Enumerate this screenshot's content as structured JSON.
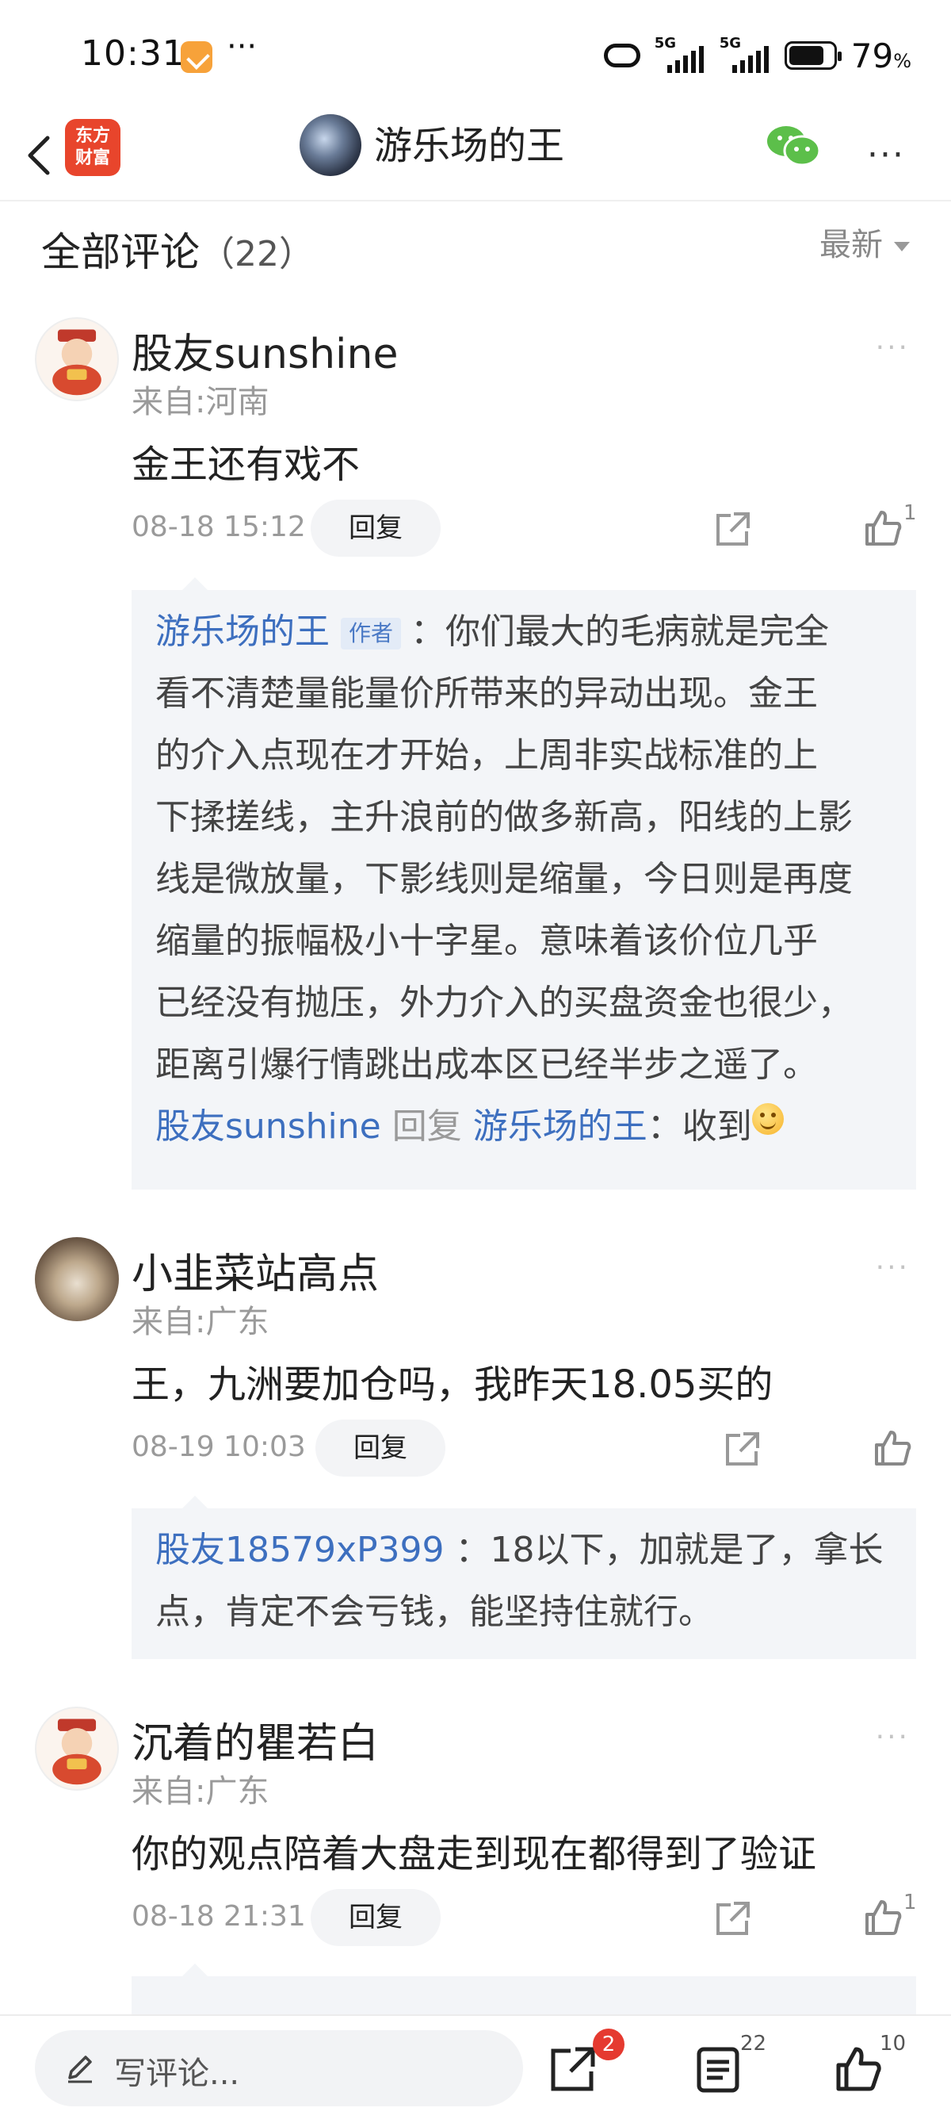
{
  "status": {
    "time": "10:31",
    "dots": "···",
    "net1": "5G",
    "net2": "5G",
    "battery": "79",
    "battery_unit": "%"
  },
  "header": {
    "logo_line1": "东方",
    "logo_line2": "财富",
    "title": "游乐场的王"
  },
  "section": {
    "title": "全部评论",
    "count": "（22）",
    "sort": "最新"
  },
  "comments": [
    {
      "user": "股友sunshine",
      "location": "来自:河南",
      "text": "金王还有戏不",
      "time": "08-18 15:12",
      "reply_label": "回复",
      "likes": "1",
      "replies": [
        {
          "author": "游乐场的王",
          "tag": "作者",
          "lines": [
            "：你们最大的毛病就是完全",
            "看不清楚量能量价所带来的异动出现。金王",
            "的介入点现在才开始，上周非实战标准的上",
            "下揉搓线，主升浪前的做多新高，阳线的上影",
            "线是微放量，下影线则是缩量，今日则是再度",
            "缩量的振幅极小十字星。意味着该价位几乎",
            "已经没有抛压，外力介入的买盘资金也很少，",
            "距离引爆行情跳出成本区已经半步之遥了。"
          ]
        },
        {
          "author": "股友sunshine",
          "verb": "回复",
          "target": "游乐场的王",
          "text": "：收到"
        }
      ]
    },
    {
      "user": "小韭菜站高点",
      "location": "来自:广东",
      "text": "王，九洲要加仓吗，我昨天18.05买的",
      "time": "08-19 10:03",
      "reply_label": "回复",
      "likes": "",
      "replies": [
        {
          "author": "股友18579xP399",
          "lines": [
            "：18以下，加就是了，拿长",
            "点，肯定不会亏钱，能坚持住就行。"
          ]
        }
      ]
    },
    {
      "user": "沉着的瞿若白",
      "location": "来自:广东",
      "text": "你的观点陪着大盘走到现在都得到了验证",
      "time": "08-18 21:31",
      "reply_label": "回复",
      "likes": "1"
    }
  ],
  "bottom": {
    "placeholder": "写评论...",
    "share_badge": "2",
    "comment_count": "22",
    "like_count": "10"
  }
}
